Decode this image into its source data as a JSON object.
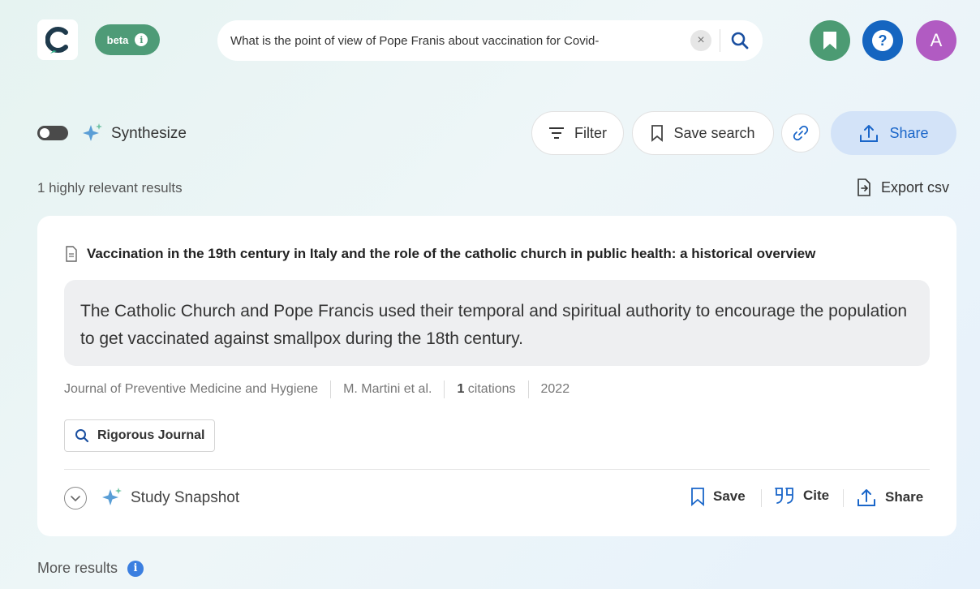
{
  "header": {
    "beta_label": "beta",
    "search": {
      "value": "What is the point of view of Pope Franis about vaccination for Covid-",
      "placeholder": ""
    },
    "avatar_initial": "A"
  },
  "toolbar": {
    "synthesize_label": "Synthesize",
    "synthesize_enabled": false,
    "filter_label": "Filter",
    "save_search_label": "Save search",
    "share_label": "Share"
  },
  "results": {
    "count_label": "1 highly relevant results",
    "export_label": "Export csv",
    "items": [
      {
        "title": "Vaccination in the 19th century in Italy and the role of the catholic church in public health: a historical overview",
        "abstract": "The Catholic Church and Pope Francis used their temporal and spiritual authority to encourage the population to get vaccinated against smallpox during the 18th century.",
        "journal": "Journal of Preventive Medicine and Hygiene",
        "authors": "M. Martini et al.",
        "citations_count": "1",
        "citations_word": "citations",
        "year": "2022",
        "tag": "Rigorous Journal",
        "snapshot_label": "Study Snapshot",
        "save_label": "Save",
        "cite_label": "Cite",
        "share_label": "Share"
      }
    ]
  },
  "more_results_label": "More results",
  "colors": {
    "brand_green": "#4e9b77",
    "help_blue": "#1565c0",
    "avatar_purple": "#b15bc2",
    "share_blue": "#1a66c9"
  },
  "icons": [
    "logo-c-icon",
    "info-icon",
    "close-icon",
    "search-icon",
    "bookmark-icon",
    "help-icon",
    "sparkle-icon",
    "filter-icon",
    "link-icon",
    "share-icon",
    "export-icon",
    "document-icon",
    "chevron-down-icon",
    "quote-icon"
  ]
}
